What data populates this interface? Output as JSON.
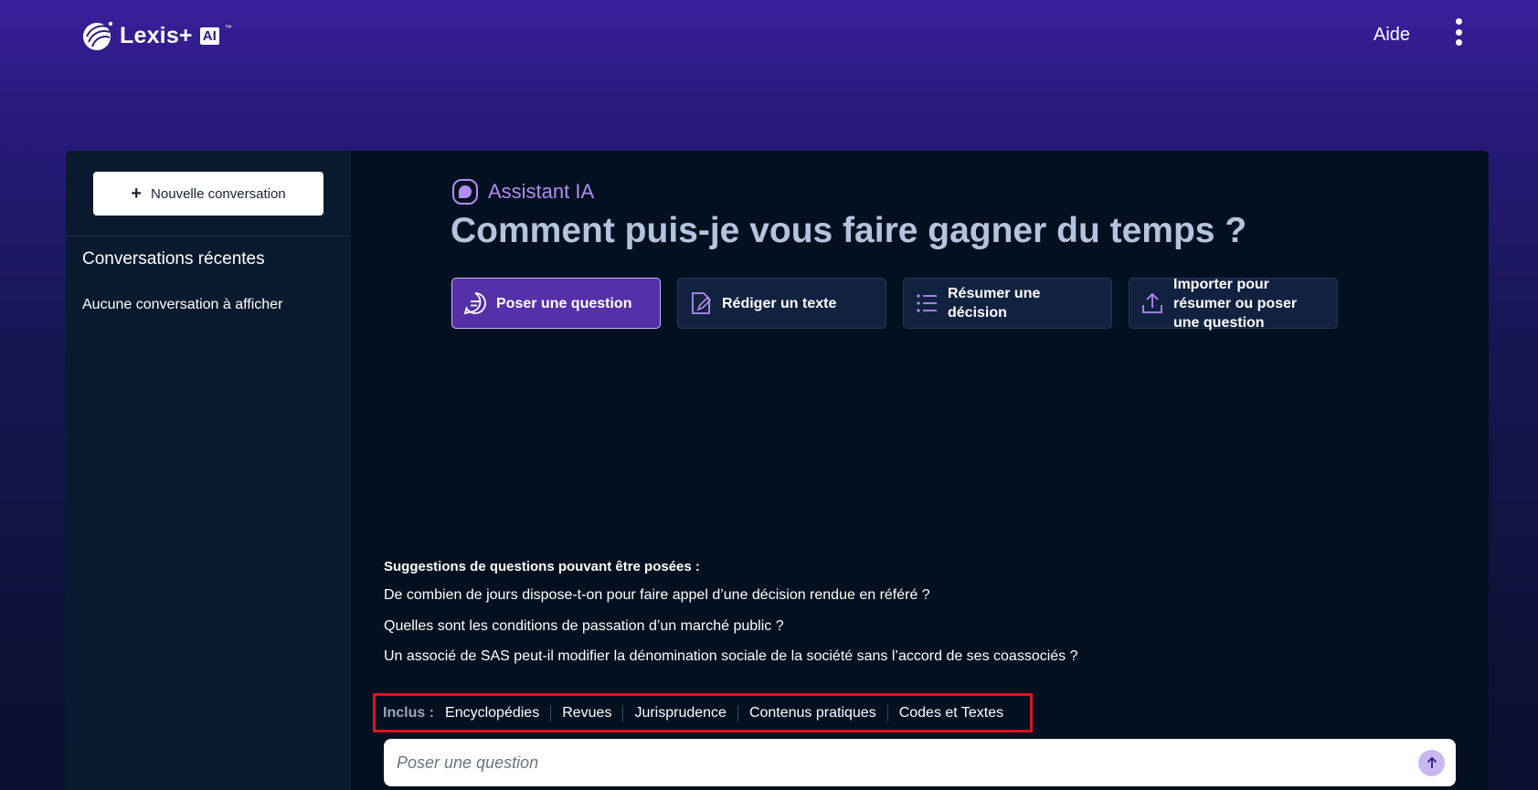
{
  "header": {
    "brand": "Lexis+",
    "brand_badge": "AI",
    "brand_tm": "™",
    "help": "Aide"
  },
  "sidebar": {
    "new_conversation": "Nouvelle conversation",
    "recent_title": "Conversations récentes",
    "empty_text": "Aucune conversation à afficher"
  },
  "main": {
    "assistant_label": "Assistant IA",
    "title": "Comment puis-je vous faire gagner du temps ?",
    "actions": [
      {
        "label": "Poser une question",
        "icon": "chat-bubble-icon",
        "active": true
      },
      {
        "label": "Rédiger un texte",
        "icon": "edit-document-icon",
        "active": false
      },
      {
        "label": "Résumer une décision",
        "icon": "list-icon",
        "active": false
      },
      {
        "label": "Importer pour résumer ou poser une question",
        "icon": "upload-icon",
        "active": false
      }
    ],
    "suggestions_title": "Suggestions de questions pouvant être posées :",
    "suggestions": [
      "De combien de jours dispose-t-on pour faire appel d’une décision rendue en référé ?",
      "Quelles sont les conditions de passation d’un marché public ?",
      "Un associé de SAS peut-il modifier la dénomination sociale de la société sans l’accord de ses coassociés ?"
    ],
    "included_label": "Inclus :",
    "included": [
      "Encyclopédies",
      "Revues",
      "Jurisprudence",
      "Contenus pratiques",
      "Codes et Textes"
    ],
    "ask_placeholder": "Poser une question"
  },
  "colors": {
    "accent": "#b38cf0",
    "active_button": "#5530a8",
    "highlight_border": "#e3101f",
    "panel": "#02101f"
  }
}
